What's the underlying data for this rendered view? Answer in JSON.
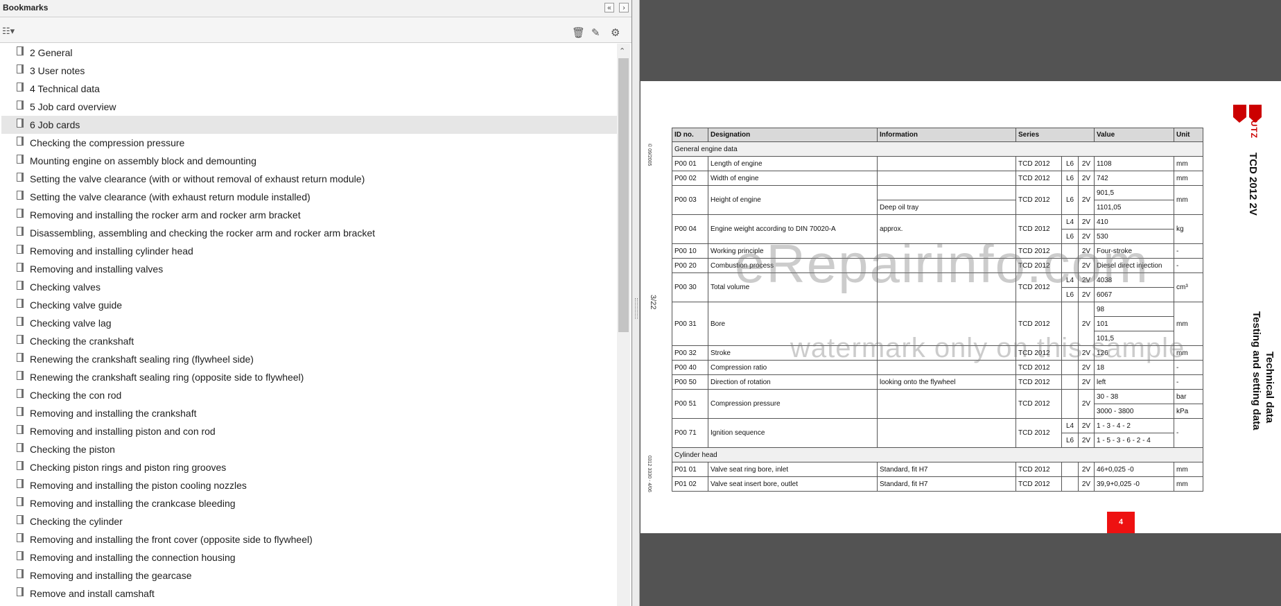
{
  "panel": {
    "title": "Bookmarks",
    "collapse_icon": "double-left-arrow-icon",
    "expand_icon": "right-arrow-icon",
    "options_icon": "options-list-icon",
    "delete_icon": "trash-icon",
    "new_bookmark_icon": "new-bookmark-icon",
    "bookmark_props_icon": "bookmark-properties-icon"
  },
  "bookmarks": [
    "2 General",
    "3 User notes",
    "4 Technical data",
    "5 Job card overview",
    "6 Job cards",
    "Checking the compression pressure",
    "Mounting engine on assembly block and demounting",
    "Setting the valve clearance (with or without removal of exhaust return module)",
    "Setting the valve clearance (with exhaust return module installed)",
    "Removing and installing the rocker arm and rocker arm bracket",
    "Disassembling, assembling and checking the rocker arm and rocker arm bracket",
    "Removing and installing cylinder head",
    "Removing and installing valves",
    "Checking valves",
    "Checking valve guide",
    "Checking valve lag",
    "Checking the crankshaft",
    "Renewing the crankshaft sealing ring (flywheel side)",
    "Renewing the crankshaft sealing ring (opposite side to flywheel)",
    "Checking the con rod",
    "Removing and installing the crankshaft",
    "Removing and installing piston and con rod",
    "Checking the piston",
    "Checking piston rings and piston ring grooves",
    "Removing and installing the piston cooling nozzles",
    "Removing and installing the crankcase bleeding",
    "Checking the cylinder",
    "Removing and installing the front cover (opposite side to flywheel)",
    "Removing and installing the connection housing",
    "Removing and installing the gearcase",
    "Remove and install camshaft"
  ],
  "selected_index": 4,
  "document": {
    "brand": "DEUTZ",
    "model": "TCD 2012 2V",
    "section_title": "Technical data",
    "section_subtitle": "Testing and setting data",
    "page_ref": "3/22",
    "left_code_top": "© 09/2005",
    "left_code_bottom": "0312 3330 - 4/06",
    "page_number": "4",
    "headers": [
      "ID no.",
      "Designation",
      "Information",
      "Series",
      "Value",
      "Unit"
    ],
    "sections": [
      "General engine data",
      "Cylinder head"
    ],
    "rows": [
      {
        "id": "P00 01",
        "des": "Length of engine",
        "info": "",
        "series": "TCD 2012",
        "cyl": "L6",
        "v": "2V",
        "val": "1108",
        "unit": "mm"
      },
      {
        "id": "P00 02",
        "des": "Width of engine",
        "info": "",
        "series": "TCD 2012",
        "cyl": "L6",
        "v": "2V",
        "val": "742",
        "unit": "mm"
      },
      {
        "id": "P00 03",
        "des": "Height of engine",
        "info": "",
        "info2": "Deep oil tray",
        "series": "TCD 2012",
        "cyl": "L6",
        "v": "2V",
        "val": "901,5",
        "val2": "1101,05",
        "unit": "mm"
      },
      {
        "id": "P00 04",
        "des": "Engine weight according to DIN 70020-A",
        "info": "approx.",
        "series": "TCD 2012",
        "cyl": "L4",
        "cyl2": "L6",
        "v": "2V",
        "v2": "2V",
        "val": "410",
        "val2": "530",
        "unit": "kg"
      },
      {
        "id": "P00 10",
        "des": "Working principle",
        "info": "",
        "series": "TCD 2012",
        "cyl": "",
        "v": "2V",
        "val": "Four-stroke",
        "unit": "-"
      },
      {
        "id": "P00 20",
        "des": "Combustion process",
        "info": "",
        "series": "TCD 2012",
        "cyl": "",
        "v": "2V",
        "val": "Diesel direct injection",
        "unit": "-"
      },
      {
        "id": "P00 30",
        "des": "Total volume",
        "info": "",
        "series": "TCD 2012",
        "cyl": "L4",
        "cyl2": "L6",
        "v": "2V",
        "v2": "2V",
        "val": "4038",
        "val2": "6067",
        "unit": "cm³"
      },
      {
        "id": "P00 31",
        "des": "Bore",
        "info": "",
        "series": "TCD 2012",
        "cyl": "",
        "v": "2V",
        "val": "98",
        "val2": "101",
        "val3": "101,5",
        "unit": "mm"
      },
      {
        "id": "P00 32",
        "des": "Stroke",
        "info": "",
        "series": "TCD 2012",
        "cyl": "",
        "v": "2V",
        "val": "126",
        "unit": "mm"
      },
      {
        "id": "P00 40",
        "des": "Compression ratio",
        "info": "",
        "series": "TCD 2012",
        "cyl": "",
        "v": "2V",
        "val": "18",
        "unit": "-"
      },
      {
        "id": "P00 50",
        "des": "Direction of rotation",
        "info": "looking onto the flywheel",
        "series": "TCD 2012",
        "cyl": "",
        "v": "2V",
        "val": "left",
        "unit": "-"
      },
      {
        "id": "P00 51",
        "des": "Compression pressure",
        "info": "",
        "series": "TCD 2012",
        "cyl": "",
        "v": "2V",
        "val": "30 - 38",
        "val2": "3000 - 3800",
        "unit": "bar",
        "unit2": "kPa"
      },
      {
        "id": "P00 71",
        "des": "Ignition sequence",
        "info": "",
        "series": "TCD 2012",
        "cyl": "L4",
        "cyl2": "L6",
        "v": "2V",
        "v2": "2V",
        "val": "1 - 3 - 4 - 2",
        "val2": "1 - 5 - 3 - 6 - 2 - 4",
        "unit": "-"
      },
      {
        "id": "P01 01",
        "des": "Valve seat ring bore, inlet",
        "info": "Standard, fit H7",
        "series": "TCD 2012",
        "cyl": "",
        "v": "2V",
        "val": "46+0,025 -0",
        "unit": "mm"
      },
      {
        "id": "P01 02",
        "des": "Valve seat insert bore, outlet",
        "info": "Standard, fit H7",
        "series": "TCD 2012",
        "cyl": "",
        "v": "2V",
        "val": "39,9+0,025 -0",
        "unit": "mm"
      }
    ]
  },
  "watermark": {
    "line1": "eRepairinfo.com",
    "line2": "watermark only on this sample"
  },
  "colors": {
    "background": "#535353",
    "selected_row": "#e6e6e6",
    "brand_red": "#ee1111"
  }
}
